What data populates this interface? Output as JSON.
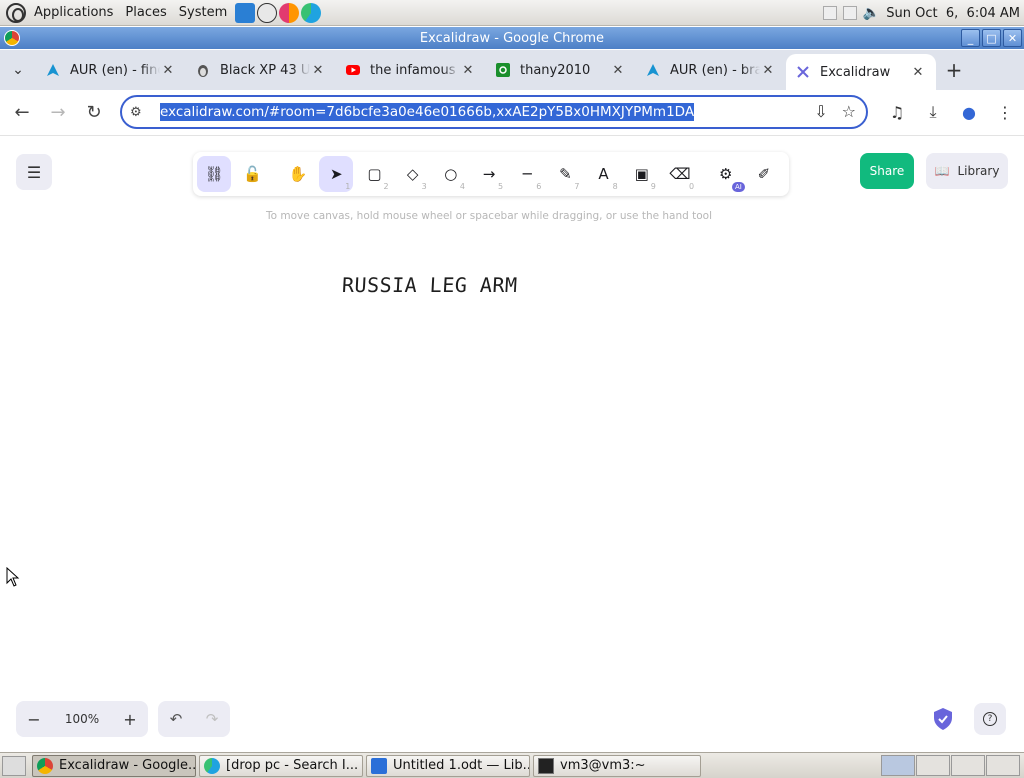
{
  "panel": {
    "menus": [
      "Applications",
      "Places",
      "System"
    ],
    "clock": "Sun Oct  6,  6:04 AM"
  },
  "window": {
    "title": "Excalidraw - Google Chrome"
  },
  "tabs": [
    {
      "label": "AUR (en) - find",
      "favicon": "arch-icon",
      "active": false
    },
    {
      "label": "Black XP 43 U",
      "favicon": "penguin-icon",
      "active": false
    },
    {
      "label": "the infamous",
      "favicon": "youtube-icon",
      "active": false
    },
    {
      "label": "thany2010",
      "favicon": "green-site-icon",
      "active": false
    },
    {
      "label": "AUR (en) - bra",
      "favicon": "arch-icon",
      "active": false
    },
    {
      "label": "Excalidraw",
      "favicon": "excalidraw-icon",
      "active": true
    }
  ],
  "toolbar": {
    "url": "excalidraw.com/#room=7d6bcfe3a0e46e01666b,xxAE2pY5Bx0HMXJYPMm1DA"
  },
  "excalidraw": {
    "tools": [
      {
        "name": "keep-selected-tool",
        "glyph": "⛓",
        "key": "",
        "selected": true
      },
      {
        "name": "lock",
        "glyph": "🔓",
        "key": "",
        "selected": false
      },
      {
        "name": "hand",
        "glyph": "✋",
        "key": "",
        "selected": false
      },
      {
        "name": "selection",
        "glyph": "➤",
        "key": "1",
        "selected": true
      },
      {
        "name": "rectangle",
        "glyph": "▢",
        "key": "2",
        "selected": false
      },
      {
        "name": "diamond",
        "glyph": "◇",
        "key": "3",
        "selected": false
      },
      {
        "name": "ellipse",
        "glyph": "○",
        "key": "4",
        "selected": false
      },
      {
        "name": "arrow",
        "glyph": "→",
        "key": "5",
        "selected": false
      },
      {
        "name": "line",
        "glyph": "─",
        "key": "6",
        "selected": false
      },
      {
        "name": "draw",
        "glyph": "✎",
        "key": "7",
        "selected": false
      },
      {
        "name": "text",
        "glyph": "A",
        "key": "8",
        "selected": false
      },
      {
        "name": "image",
        "glyph": "▣",
        "key": "9",
        "selected": false
      },
      {
        "name": "eraser",
        "glyph": "⌫",
        "key": "0",
        "selected": false
      },
      {
        "name": "more-tools",
        "glyph": "⚙",
        "key": "",
        "badge": "AI",
        "selected": false
      },
      {
        "name": "laser",
        "glyph": "✐",
        "key": "",
        "selected": false
      }
    ],
    "share_label": "Share",
    "library_label": "Library",
    "hint": "To move canvas, hold mouse wheel or spacebar while dragging, or use the hand tool",
    "canvas_text": "RUSSIA LEG ARM",
    "zoom": "100%"
  },
  "taskbar": {
    "tasks": [
      {
        "label": "Excalidraw - Google...",
        "icon": "chrome-icon",
        "active": true
      },
      {
        "label": "[drop pc - Search I...",
        "icon": "edge-icon",
        "active": false
      },
      {
        "label": "Untitled 1.odt — Lib...",
        "icon": "writer-icon",
        "active": false
      },
      {
        "label": "vm3@vm3:~",
        "icon": "terminal-icon",
        "active": false
      }
    ]
  },
  "colors": {
    "accent": "#6965db",
    "share": "#11ba7e",
    "selection": "#3367d6"
  }
}
